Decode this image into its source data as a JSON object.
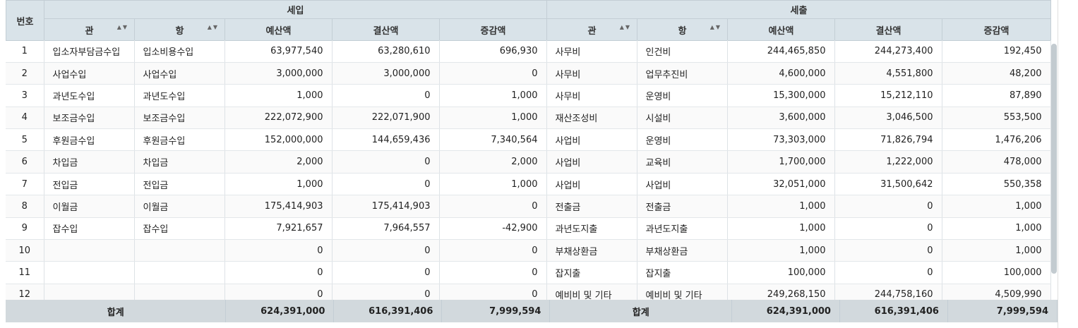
{
  "header": {
    "no": "번호",
    "income": "세입",
    "expense": "세출",
    "gwan": "관",
    "hang": "항",
    "budget": "예산액",
    "settle": "결산액",
    "diff": "증감액"
  },
  "rows": [
    [
      "1",
      "입소자부담금수입",
      "입소비용수입",
      "63,977,540",
      "63,280,610",
      "696,930",
      "사무비",
      "인건비",
      "244,465,850",
      "244,273,400",
      "192,450"
    ],
    [
      "2",
      "사업수입",
      "사업수입",
      "3,000,000",
      "3,000,000",
      "0",
      "사무비",
      "업무추진비",
      "4,600,000",
      "4,551,800",
      "48,200"
    ],
    [
      "3",
      "과년도수입",
      "과년도수입",
      "1,000",
      "0",
      "1,000",
      "사무비",
      "운영비",
      "15,300,000",
      "15,212,110",
      "87,890"
    ],
    [
      "4",
      "보조금수입",
      "보조금수입",
      "222,072,900",
      "222,071,900",
      "1,000",
      "재산조성비",
      "시설비",
      "3,600,000",
      "3,046,500",
      "553,500"
    ],
    [
      "5",
      "후원금수입",
      "후원금수입",
      "152,000,000",
      "144,659,436",
      "7,340,564",
      "사업비",
      "운영비",
      "73,303,000",
      "71,826,794",
      "1,476,206"
    ],
    [
      "6",
      "차입금",
      "차입금",
      "2,000",
      "0",
      "2,000",
      "사업비",
      "교육비",
      "1,700,000",
      "1,222,000",
      "478,000"
    ],
    [
      "7",
      "전입금",
      "전입금",
      "1,000",
      "0",
      "1,000",
      "사업비",
      " 사업비",
      "32,051,000",
      "31,500,642",
      "550,358"
    ],
    [
      "8",
      "이월금",
      "이월금",
      "175,414,903",
      "175,414,903",
      "0",
      "전출금",
      "전출금",
      "1,000",
      "0",
      "1,000"
    ],
    [
      "9",
      "잡수입",
      "잡수입",
      "7,921,657",
      "7,964,557",
      "-42,900",
      "과년도지출",
      "과년도지출",
      "1,000",
      "0",
      "1,000"
    ],
    [
      "10",
      "",
      "",
      "0",
      "0",
      "0",
      "부채상환금",
      "부채상환금",
      "1,000",
      "0",
      "1,000"
    ],
    [
      "11",
      "",
      "",
      "0",
      "0",
      "0",
      "잡지출",
      "잡지출",
      "100,000",
      "0",
      "100,000"
    ],
    [
      "12",
      "",
      "",
      "0",
      "0",
      "0",
      "예비비 및 기타",
      "예비비 및 기타",
      "249,268,150",
      "244,758,160",
      "4,509,990"
    ]
  ],
  "footer": {
    "label": "합계",
    "in_budget": "624,391,000",
    "in_settle": "616,391,406",
    "in_diff": "7,999,594",
    "ex_label": "합계",
    "ex_budget": "624,391,000",
    "ex_settle": "616,391,406",
    "ex_diff": "7,999,594"
  }
}
